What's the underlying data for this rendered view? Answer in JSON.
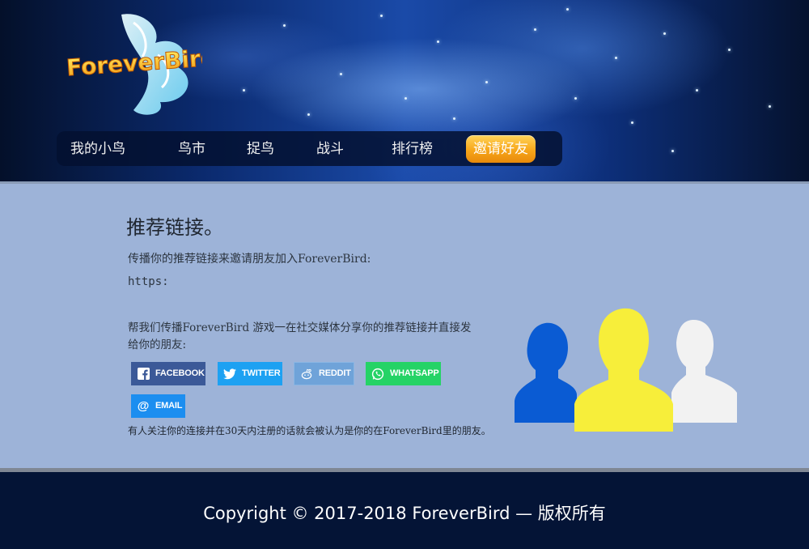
{
  "brand": {
    "logo_text": "ForeverBird",
    "logo_icon": "bird-wing-logo"
  },
  "nav": {
    "items": [
      {
        "label": "我的小鸟"
      },
      {
        "label": "鸟市"
      },
      {
        "label": "捉鸟"
      },
      {
        "label": "战斗"
      },
      {
        "label": "排行榜"
      },
      {
        "label": "邀请好友",
        "active": true
      }
    ]
  },
  "main": {
    "title": "推荐链接。",
    "intro": "传播你的推荐链接来邀请朋友加入ForeverBird:",
    "link": "https:",
    "share_text": "帮我们传播ForeverBird 游戏一在社交媒体分享你的推荐链接并直接发给你的朋友:",
    "buttons": {
      "facebook": {
        "label": "FACEBOOK",
        "icon": "facebook-icon",
        "color": "#3b5998"
      },
      "twitter": {
        "label": "TWITTER",
        "icon": "twitter-icon",
        "color": "#1da1f2"
      },
      "reddit": {
        "label": "REDDIT",
        "icon": "reddit-icon",
        "color": "#6fa3d9"
      },
      "whatsapp": {
        "label": "WHATSAPP",
        "icon": "whatsapp-icon",
        "color": "#25d366"
      },
      "email": {
        "label": "EMAIL",
        "icon": "email-icon",
        "color": "#1c8ef0"
      }
    },
    "note": "有人关注你的连接并在30天内注册的话就会被认为是你的在ForeverBird里的朋友。",
    "illustration": {
      "icon": "friends-silhouettes-icon",
      "colors": [
        "#0a5bd3",
        "#f7ee3a",
        "#f2f2f2"
      ]
    }
  },
  "footer": {
    "copyright": "Copyright © 2017-2018 ForeverBird — 版权所有"
  },
  "colors": {
    "accent": "#f7a61a",
    "header_dark": "#04102a",
    "body_bg": "#9db3d8",
    "footer_bg": "#041436"
  }
}
